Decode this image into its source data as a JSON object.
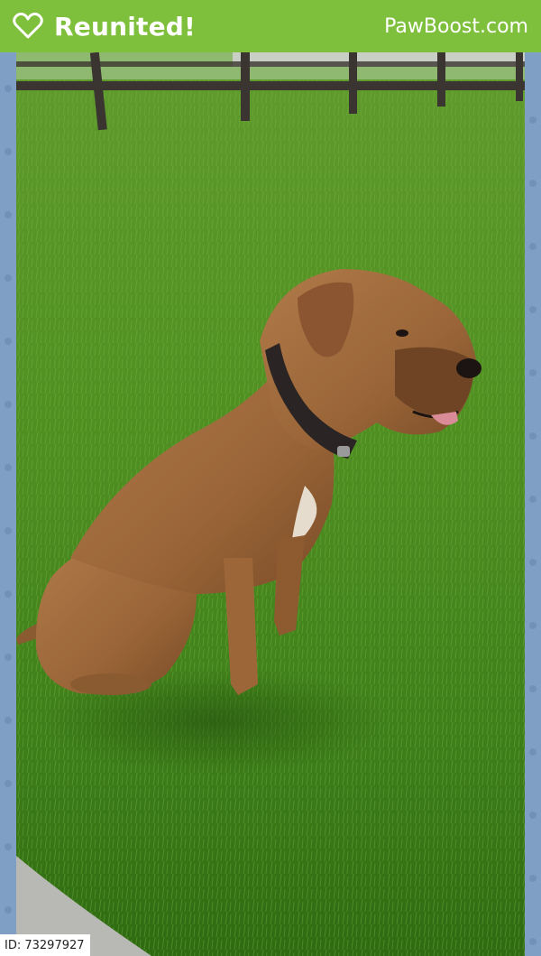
{
  "banner": {
    "status_label": "Reunited!",
    "brand": "PawBoost.com",
    "background_color": "#7ec03c",
    "icon": "heart-icon"
  },
  "photo": {
    "subject": "pet-photo"
  },
  "listing": {
    "id_label": "ID: 73297927"
  },
  "border": {
    "color": "#7f9fc4",
    "pattern_icon": "paw-print-icon"
  }
}
